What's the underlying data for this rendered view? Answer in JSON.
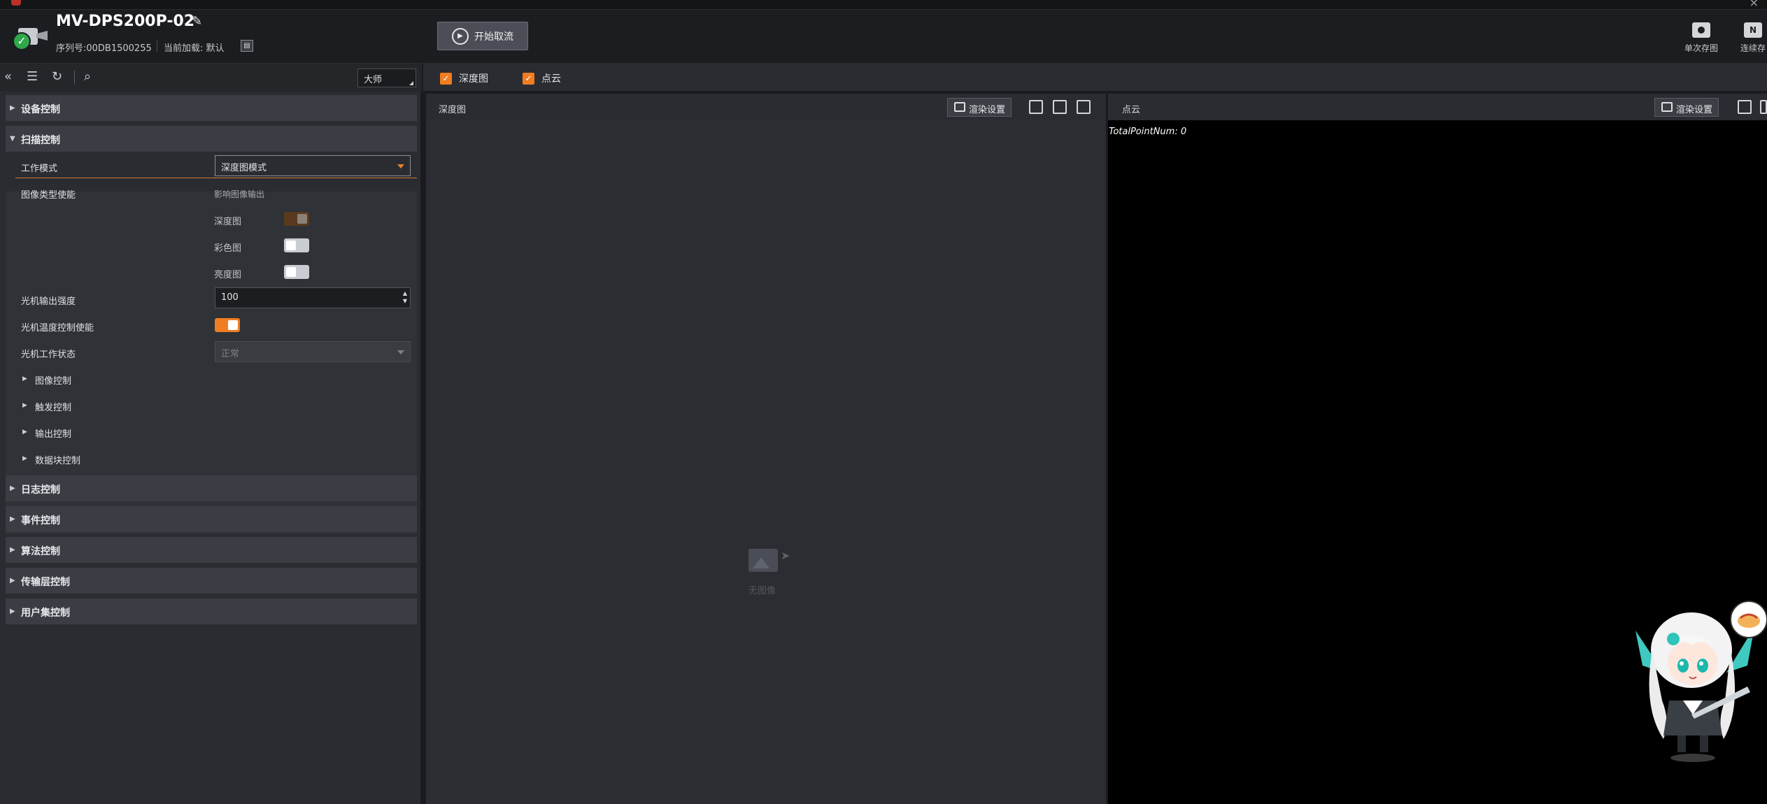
{
  "header": {
    "device_name": "MV-DPS200P-02",
    "serial": "序列号:00DB1500255",
    "load_label": "当前加载:",
    "load_value": "默认",
    "start_button": "开始取流",
    "single_save": "单次存图",
    "continuous_save": "连续存"
  },
  "left_toolbar": {
    "user_level": "大师"
  },
  "sections": {
    "device_control": "设备控制",
    "scan_control": "扫描控制",
    "log_control": "日志控制",
    "event_control": "事件控制",
    "algorithm_control": "算法控制",
    "transport_control": "传输层控制",
    "userset_control": "用户集控制"
  },
  "scan": {
    "work_mode_label": "工作模式",
    "work_mode_value": "深度图模式",
    "image_type_label": "图像类型使能",
    "image_type_note": "影响图像输出",
    "depth_label": "深度图",
    "color_label": "彩色图",
    "brightness_label": "亮度图",
    "light_output_label": "光机输出强度",
    "light_output_value": "100",
    "light_temp_label": "光机温度控制使能",
    "light_status_label": "光机工作状态",
    "light_status_value": "正常",
    "sub_image": "图像控制",
    "sub_trigger": "触发控制",
    "sub_output": "输出控制",
    "sub_chunk": "数据块控制"
  },
  "view_toolbar": {
    "depth_check": "深度图",
    "cloud_check": "点云"
  },
  "depth_pane": {
    "title": "深度图",
    "render_button": "渲染设置",
    "no_image": "无图像"
  },
  "cloud_pane": {
    "title": "点云",
    "render_button": "渲染设置",
    "total_points": "TotalPointNum: 0"
  }
}
